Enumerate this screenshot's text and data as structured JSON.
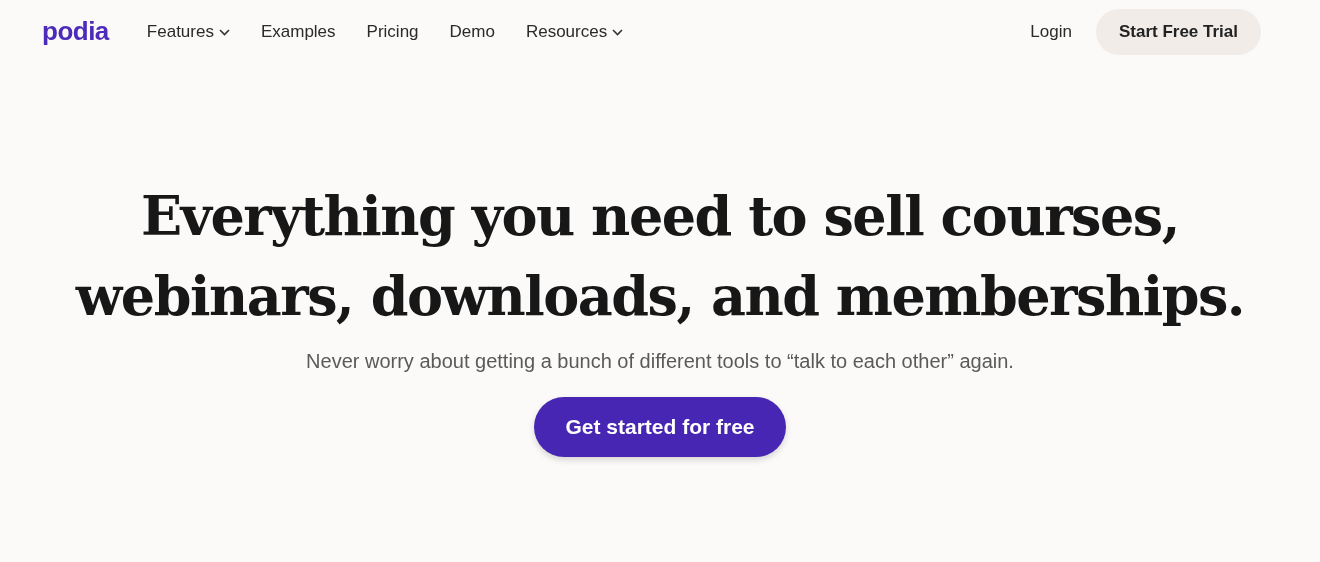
{
  "header": {
    "logo": "podia",
    "nav": [
      {
        "label": "Features",
        "has_menu": true
      },
      {
        "label": "Examples",
        "has_menu": false
      },
      {
        "label": "Pricing",
        "has_menu": false
      },
      {
        "label": "Demo",
        "has_menu": false
      },
      {
        "label": "Resources",
        "has_menu": true
      }
    ],
    "login": "Login",
    "cta": "Start Free Trial"
  },
  "hero": {
    "headline_lines": [
      "Everything you need to sell courses,",
      "webinars, downloads, and memberships."
    ],
    "subheadline": "Never worry about getting a bunch of different tools to “talk to each other” again.",
    "cta": "Get started for free"
  }
}
